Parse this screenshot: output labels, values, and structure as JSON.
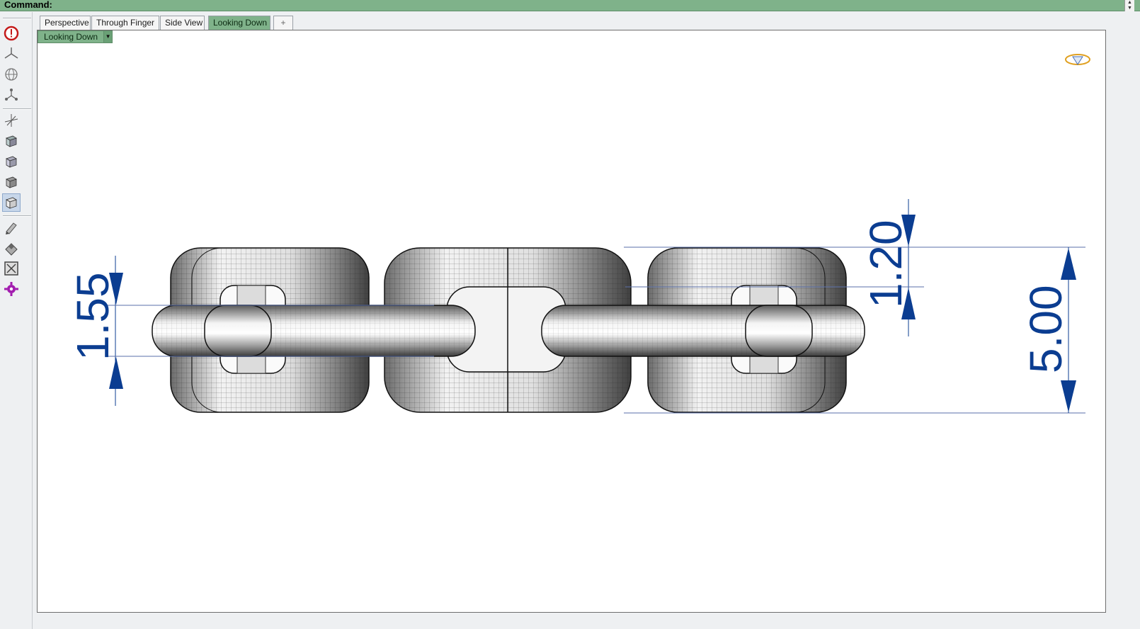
{
  "command_bar": {
    "label": "Command:"
  },
  "tabs": [
    {
      "label": "Perspective",
      "active": false
    },
    {
      "label": "Through Finger",
      "active": false
    },
    {
      "label": "Side View",
      "active": false
    },
    {
      "label": "Looking Down",
      "active": true
    }
  ],
  "tab_add": {
    "icon": "plus-icon"
  },
  "viewport": {
    "label": "Looking Down",
    "menu_icon": "chevron-down-icon",
    "corner_icon": "gem-icon"
  },
  "toolbar": {
    "tools": [
      {
        "name": "stop-icon"
      },
      {
        "name": "three-axis-icon"
      },
      {
        "name": "globe-grid-icon"
      },
      {
        "name": "node-graph-icon"
      },
      {
        "name": "axis-move-icon"
      },
      {
        "name": "cube-view-1-icon"
      },
      {
        "name": "cube-view-2-icon"
      },
      {
        "name": "cube-view-3-icon"
      },
      {
        "name": "cube-view-4-icon",
        "active": true
      },
      {
        "name": "pencil-tool-icon"
      },
      {
        "name": "eraser-tool-icon"
      },
      {
        "name": "fit-frame-icon"
      },
      {
        "name": "gear-purple-icon"
      }
    ]
  },
  "dimensions": {
    "left": "1.55",
    "middle": "1.20",
    "right": "5.00"
  },
  "colors": {
    "accent_green": "#7fb28a",
    "dimension_blue": "#0b3d91"
  }
}
